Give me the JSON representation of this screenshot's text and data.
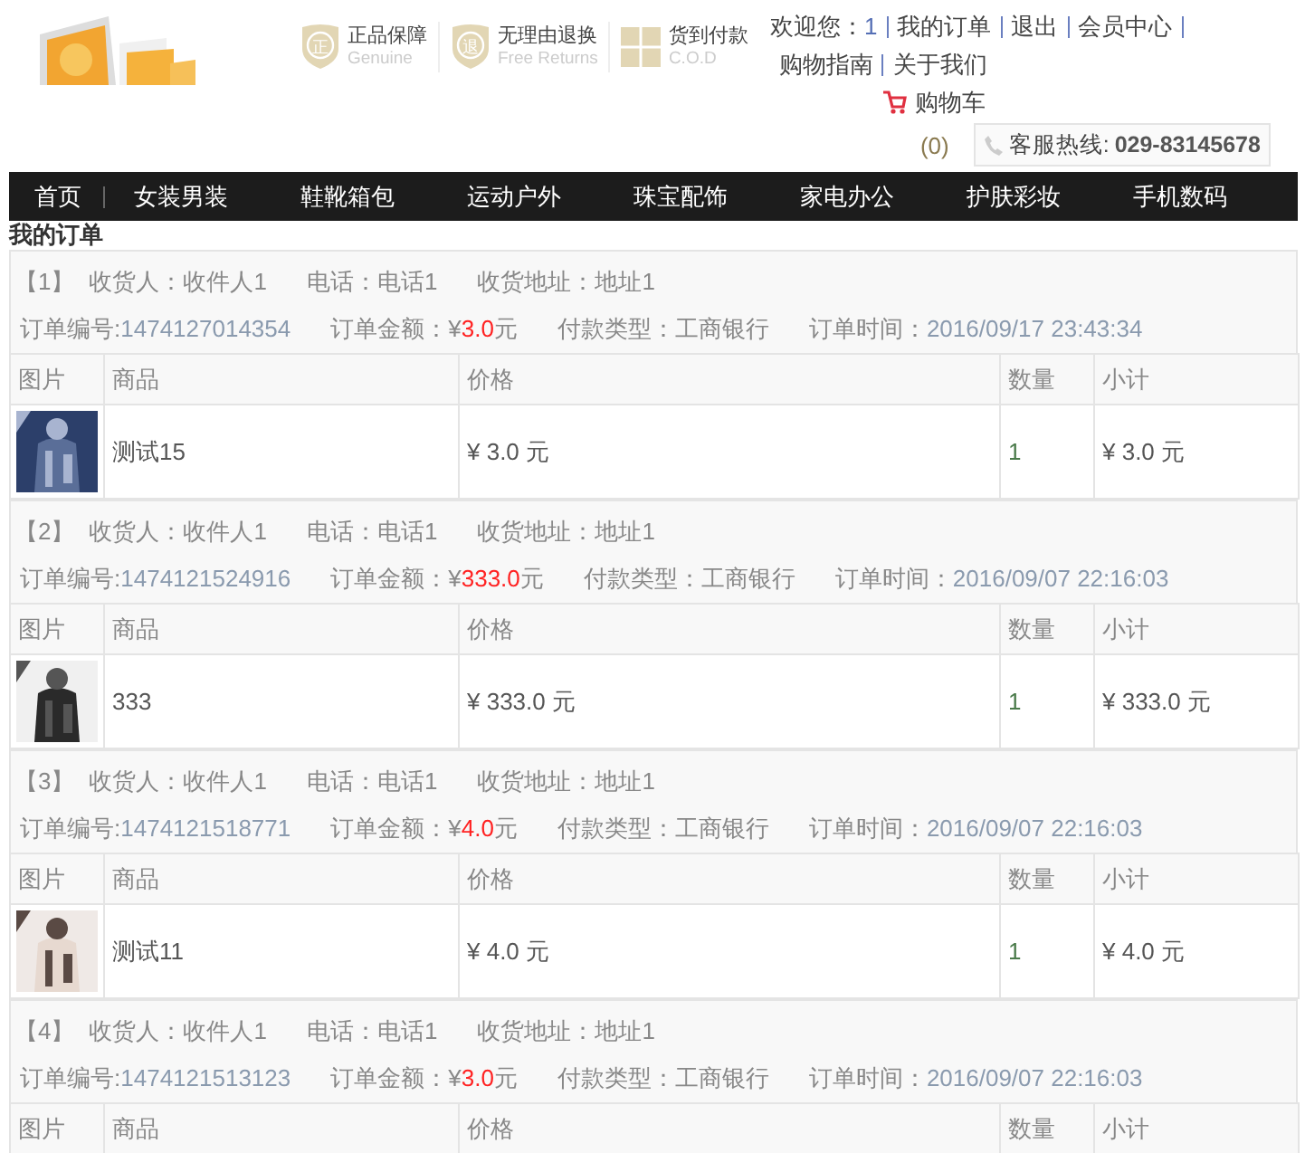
{
  "header": {
    "badges": [
      {
        "kind": "shield",
        "glyph": "正",
        "title": "正品保障",
        "subtitle": "Genuine"
      },
      {
        "kind": "shield",
        "glyph": "退",
        "title": "无理由退换",
        "subtitle": "Free Returns"
      },
      {
        "kind": "gift",
        "title": "货到付款",
        "subtitle": "C.O.D"
      }
    ],
    "welcome": "欢迎您：",
    "user": "1",
    "links": [
      "我的订单",
      "退出",
      "会员中心",
      "购物指南",
      "关于我们"
    ],
    "cart": "购物车",
    "cart_count": "(0)",
    "hotline_label": "客服热线:",
    "hotline": "029-83145678"
  },
  "nav": [
    "首页",
    "女装男装",
    "鞋靴箱包",
    "运动户外",
    "珠宝配饰",
    "家电办公",
    "护肤彩妆",
    "手机数码"
  ],
  "page_title": "我的订单",
  "orders": [
    {
      "index": "【1】",
      "receiver": "收货人：收件人1",
      "phone": "电话：电话1",
      "address": "收货地址：地址1",
      "number_label": "订单编号:",
      "number": "1474127014354",
      "amount_label": "订单金额：",
      "currency": "¥",
      "amount": "3.0",
      "unit": "元",
      "payment": "付款类型：工商银行",
      "time_label": "订单时间：",
      "time": "2016/09/17 23:43:34",
      "columns": [
        "图片",
        "商品",
        "价格",
        "数量",
        "小计"
      ],
      "items": [
        {
          "kind": "plaid",
          "name": "测试15",
          "price": "¥ 3.0 元",
          "qty": "1",
          "subtotal": "¥ 3.0 元"
        }
      ]
    },
    {
      "index": "【2】",
      "receiver": "收货人：收件人1",
      "phone": "电话：电话1",
      "address": "收货地址：地址1",
      "number_label": "订单编号:",
      "number": "1474121524916",
      "amount_label": "订单金额：",
      "currency": "¥",
      "amount": "333.0",
      "unit": "元",
      "payment": "付款类型：工商银行",
      "time_label": "订单时间：",
      "time": "2016/09/07 22:16:03",
      "columns": [
        "图片",
        "商品",
        "价格",
        "数量",
        "小计"
      ],
      "items": [
        {
          "kind": "dark",
          "name": "333",
          "price": "¥ 333.0 元",
          "qty": "1",
          "subtotal": "¥ 333.0 元"
        }
      ]
    },
    {
      "index": "【3】",
      "receiver": "收货人：收件人1",
      "phone": "电话：电话1",
      "address": "收货地址：地址1",
      "number_label": "订单编号:",
      "number": "1474121518771",
      "amount_label": "订单金额：",
      "currency": "¥",
      "amount": "4.0",
      "unit": "元",
      "payment": "付款类型：工商银行",
      "time_label": "订单时间：",
      "time": "2016/09/07 22:16:03",
      "columns": [
        "图片",
        "商品",
        "价格",
        "数量",
        "小计"
      ],
      "items": [
        {
          "kind": "light",
          "name": "测试11",
          "price": "¥ 4.0 元",
          "qty": "1",
          "subtotal": "¥ 4.0 元"
        }
      ]
    },
    {
      "index": "【4】",
      "receiver": "收货人：收件人1",
      "phone": "电话：电话1",
      "address": "收货地址：地址1",
      "number_label": "订单编号:",
      "number": "1474121513123",
      "amount_label": "订单金额：",
      "currency": "¥",
      "amount": "3.0",
      "unit": "元",
      "payment": "付款类型：工商银行",
      "time_label": "订单时间：",
      "time": "2016/09/07 22:16:03",
      "columns": [
        "图片",
        "商品",
        "价格",
        "数量",
        "小计"
      ]
    }
  ]
}
